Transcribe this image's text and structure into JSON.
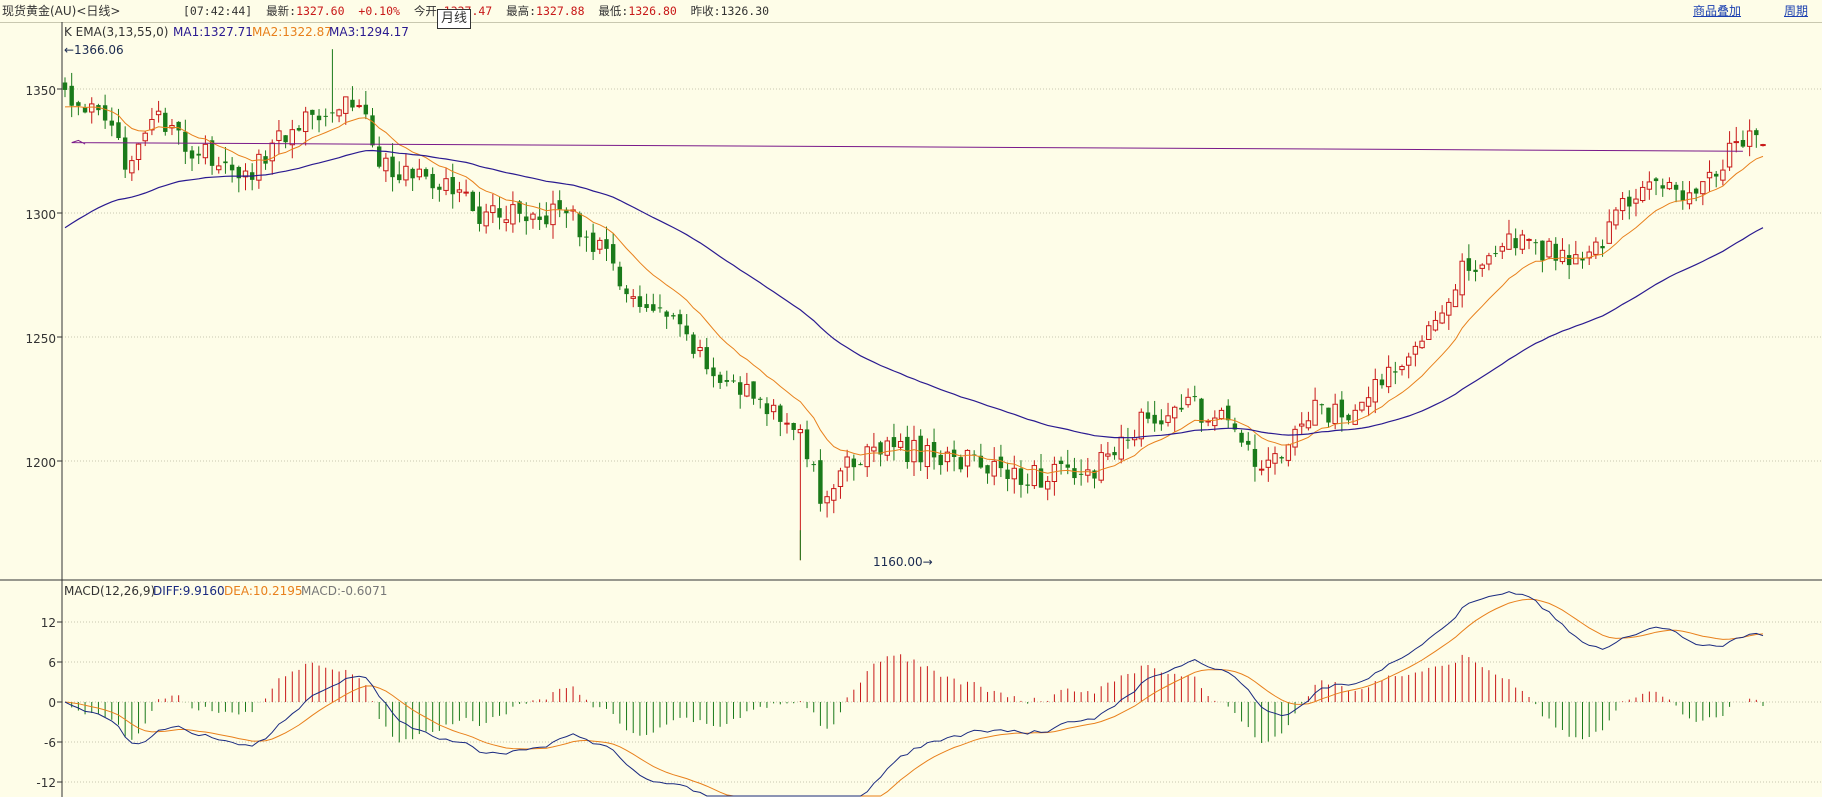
{
  "header": {
    "instrument": "现货黄金(AU)<日线>",
    "time": "[07:42:44]",
    "latest_label": "最新:",
    "latest_value": "1327.60",
    "change": "+0.10%",
    "open_label": "今开:",
    "open_value": "1327.47",
    "high_label": "最高:",
    "high_value": "1327.88",
    "low_label": "最低:",
    "low_value": "1326.80",
    "prev_close_label": "昨收:",
    "prev_close_value": "1326.30",
    "period_popup": "月线",
    "overlay_link": "商品叠加",
    "cycle_link": "周期"
  },
  "price_pane": {
    "indicator_title": "K  EMA(3,13,55,0)",
    "ma1_label": "MA1:1327.71",
    "ma2_label": "MA2:1322.87",
    "ma3_label": "MA3:1294.17",
    "max_marker": "←1366.06",
    "min_marker": "1160.00→",
    "y_ticks": [
      "1350",
      "1300",
      "1250",
      "1200"
    ]
  },
  "macd_pane": {
    "title": "MACD(12,26,9)",
    "diff_label": "DIFF:9.9160",
    "dea_label": "DEA:10.2195",
    "macd_label": "MACD:-0.6071",
    "y_ticks": [
      "12",
      "6",
      "0",
      "-6",
      "-12"
    ]
  },
  "colors": {
    "background": "#fefde8",
    "up_candle": "#c81818",
    "down_candle": "#1a7a1a",
    "ma_fast": "#e8801c",
    "ma_slow": "#2a1a90",
    "diff_line": "#1a2a80",
    "dea_line": "#e8801c",
    "grid": "#c8c8b0"
  },
  "chart_data": [
    {
      "type": "candlestick",
      "title": "现货黄金(AU)<日线>",
      "indicators": [
        "EMA(3,13,55,0)"
      ],
      "ylim": [
        1160,
        1370
      ],
      "y_ticks": [
        1350,
        1300,
        1250,
        1200
      ],
      "max_price": 1366.06,
      "min_price": 1160.0,
      "last": {
        "open": 1327.47,
        "high": 1327.88,
        "low": 1326.8,
        "close": 1327.6
      },
      "ma_last": {
        "MA1": 1327.71,
        "MA2": 1322.87,
        "MA3": 1294.17
      },
      "grid": true
    },
    {
      "type": "macd",
      "params": [
        12,
        26,
        9
      ],
      "ylim": [
        -14,
        16
      ],
      "y_ticks": [
        12,
        6,
        0,
        -6,
        -12
      ],
      "last": {
        "DIFF": 9.916,
        "DEA": 10.2195,
        "MACD": -0.6071
      },
      "grid": true
    }
  ]
}
